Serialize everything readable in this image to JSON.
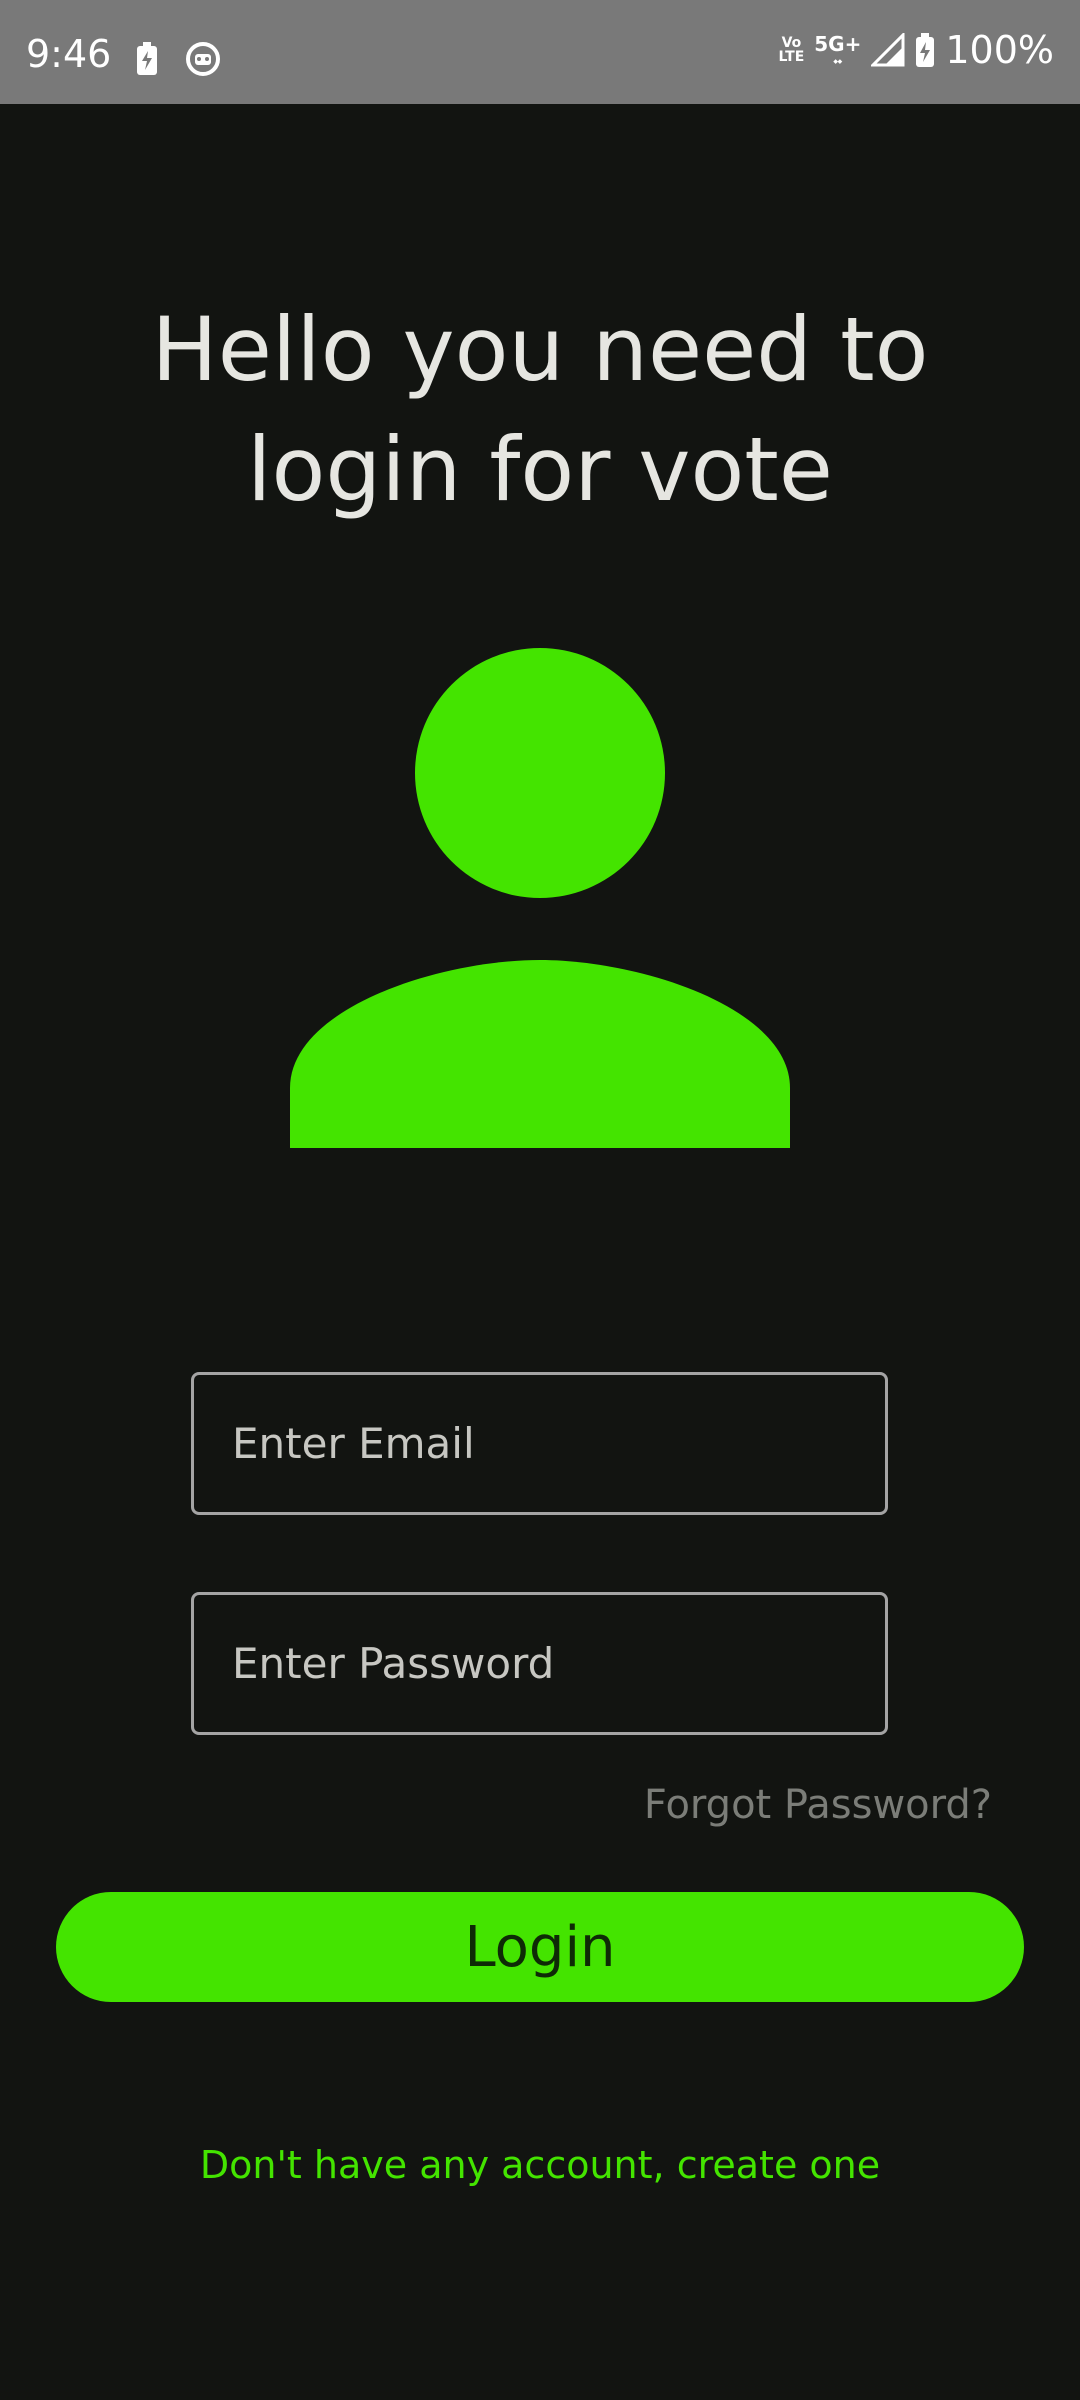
{
  "status_bar": {
    "time": "9:46",
    "network_top": "Vo",
    "network_bottom": "LTE",
    "signal_top": "5G+",
    "battery_percent": "100%",
    "icons": [
      "charging-bolt-icon",
      "robot-icon",
      "volte-icon",
      "5g-icon",
      "signal-icon",
      "battery-icon"
    ]
  },
  "header": {
    "title": "Hello you need to login for vote"
  },
  "avatar": {
    "icon": "user-icon",
    "color": "#44e400"
  },
  "form": {
    "email_placeholder": "Enter Email",
    "email_value": "",
    "password_placeholder": "Enter Password",
    "password_value": "",
    "forgot_label": "Forgot Password?",
    "login_label": "Login",
    "create_account_label": "Don't have any account, create one"
  },
  "colors": {
    "background": "#121411",
    "accent": "#44e400",
    "status_bar": "#797979",
    "text": "#e6e6e1",
    "muted": "#7b7d78"
  }
}
